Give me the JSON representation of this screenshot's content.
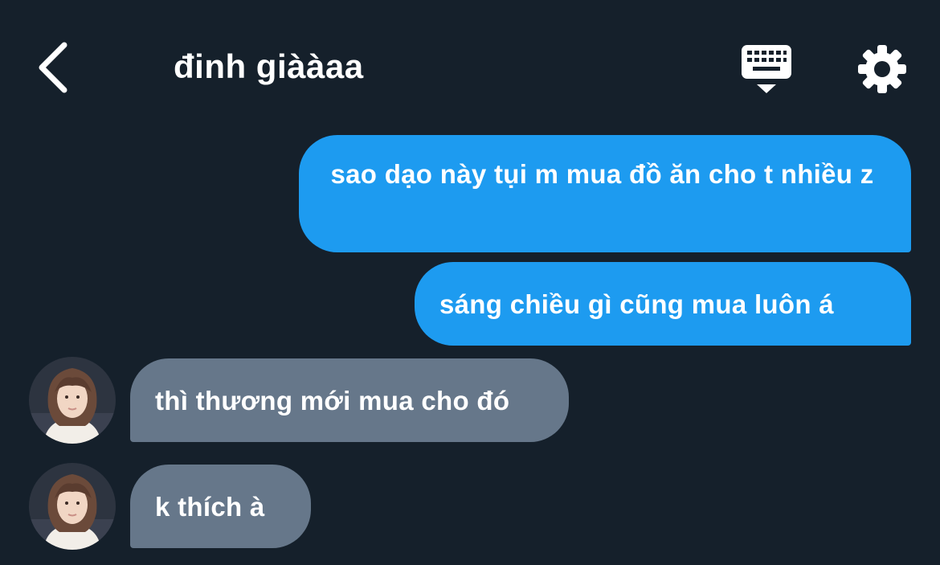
{
  "header": {
    "title": "đinh giààaa",
    "icons": {
      "back": "chevron-left-icon",
      "keyboard": "keyboard-icon",
      "settings": "gear-icon"
    }
  },
  "messages": [
    {
      "direction": "sent",
      "text": " sao dạo này tụi m mua đồ ăn cho t nhiều z"
    },
    {
      "direction": "sent",
      "text": "sáng chiều gì cũng mua luôn á"
    },
    {
      "direction": "received",
      "text": "thì thương mới mua cho đó"
    },
    {
      "direction": "received",
      "text": "k thích à"
    }
  ],
  "colors": {
    "background": "#15202b",
    "sent_bubble": "#1d9bf0",
    "received_bubble": "#66778a",
    "text": "#ffffff"
  }
}
